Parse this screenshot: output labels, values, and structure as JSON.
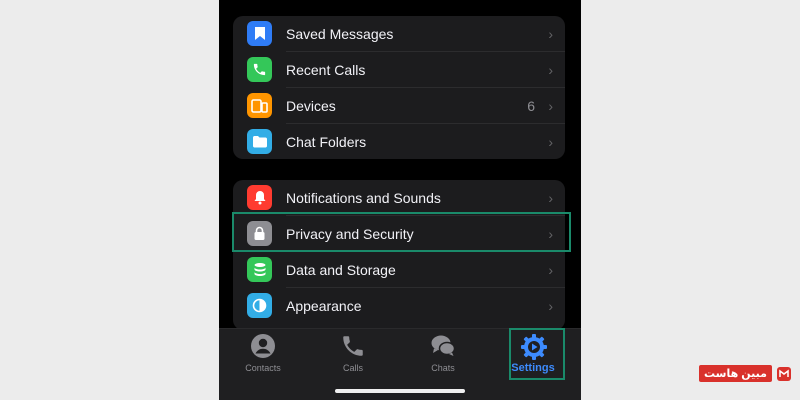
{
  "colors": {
    "accent": "#3d8bfd",
    "highlight_border": "#1a8a6a",
    "group_bg": "#1c1c1e"
  },
  "group1": {
    "items": [
      {
        "label": "Saved Messages",
        "icon": "bookmark-icon",
        "icon_bg": "#2f7cf6",
        "value": ""
      },
      {
        "label": "Recent Calls",
        "icon": "phone-icon",
        "icon_bg": "#34c759",
        "value": ""
      },
      {
        "label": "Devices",
        "icon": "devices-icon",
        "icon_bg": "#ff9500",
        "value": "6"
      },
      {
        "label": "Chat Folders",
        "icon": "folder-icon",
        "icon_bg": "#32ade6",
        "value": ""
      }
    ]
  },
  "group2": {
    "items": [
      {
        "label": "Notifications and Sounds",
        "icon": "bell-icon",
        "icon_bg": "#ff3b30"
      },
      {
        "label": "Privacy and Security",
        "icon": "lock-icon",
        "icon_bg": "#8e8e93"
      },
      {
        "label": "Data and Storage",
        "icon": "database-icon",
        "icon_bg": "#34c759"
      },
      {
        "label": "Appearance",
        "icon": "appearance-icon",
        "icon_bg": "#32ade6"
      }
    ]
  },
  "tabbar": {
    "tabs": [
      {
        "label": "Contacts",
        "icon": "person-icon"
      },
      {
        "label": "Calls",
        "icon": "phone-icon"
      },
      {
        "label": "Chats",
        "icon": "chat-bubbles-icon"
      },
      {
        "label": "Settings",
        "icon": "gear-icon",
        "active": true
      }
    ]
  },
  "watermark": {
    "text": "مبین هاست"
  }
}
